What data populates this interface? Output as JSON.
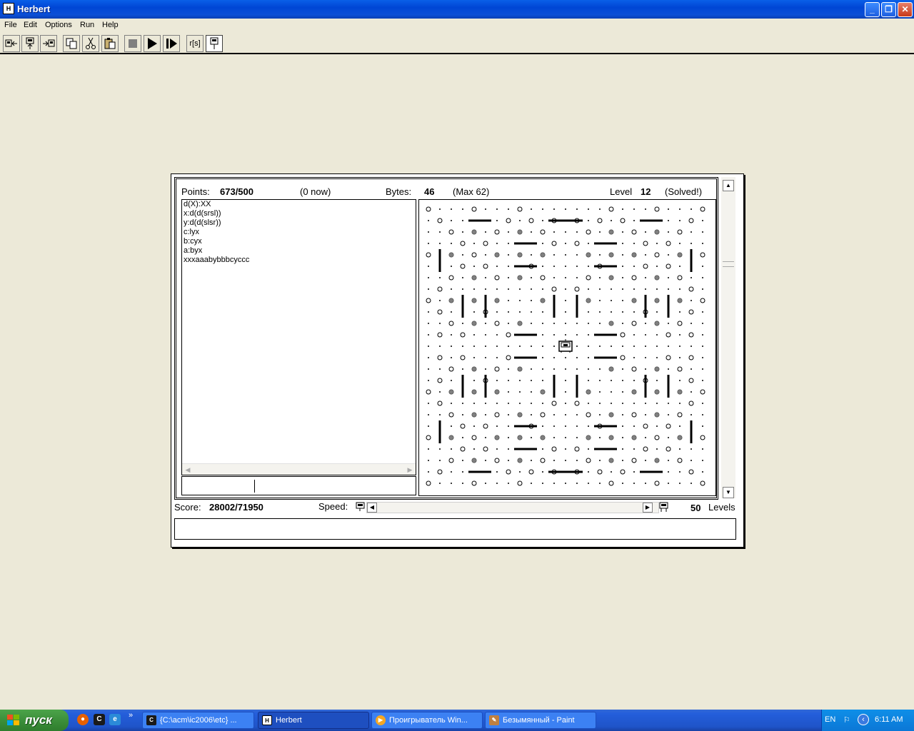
{
  "window": {
    "title": "Herbert",
    "icon_label": "H",
    "controls": [
      "minimize",
      "restore",
      "close"
    ]
  },
  "menu": [
    "File",
    "Edit",
    "Options",
    "Run",
    "Help"
  ],
  "toolbar": {
    "buttons": [
      {
        "name": "prev-level-button",
        "icon": "prev-level-icon"
      },
      {
        "name": "load-button",
        "icon": "load-icon"
      },
      {
        "name": "next-level-button",
        "icon": "next-level-icon"
      },
      {
        "name": "copy-button",
        "icon": "copy-icon"
      },
      {
        "name": "cut-button",
        "icon": "scissors-icon"
      },
      {
        "name": "paste-button",
        "icon": "paste-icon"
      },
      {
        "name": "stop-button",
        "icon": "stop-icon"
      },
      {
        "name": "run-button",
        "icon": "play-icon"
      },
      {
        "name": "step-button",
        "icon": "step-icon"
      },
      {
        "name": "syntax-button",
        "icon": "syntax-icon",
        "label": "r[s]"
      },
      {
        "name": "herbert-button",
        "icon": "robot-icon"
      }
    ]
  },
  "stats": {
    "points_label": "Points:",
    "points_value": "673/500",
    "points_now": "(0 now)",
    "bytes_label": "Bytes:",
    "bytes_value": "46",
    "bytes_max": "(Max 62)",
    "level_label": "Level",
    "level_value": "12",
    "level_status": "(Solved!)"
  },
  "code": {
    "lines": [
      "d(X):XX",
      "x:d(d(srsl))",
      "y:d(d(slsr))",
      "c:lyx",
      "b:cyx",
      "a:byx",
      "xxxaaabybbbcyccc"
    ],
    "input_value": ""
  },
  "bottom": {
    "score_label": "Score:",
    "score_value": "28002/71950",
    "speed_label": "Speed:",
    "speed_level": 0.98,
    "levels_value": "50",
    "levels_label": "Levels"
  },
  "status_message": "",
  "board": {
    "grid_size": 25,
    "robot_cell": [
      12,
      12
    ],
    "colors": {
      "dot": "#000000",
      "ring": "#000000",
      "filled": "#808080",
      "wall": "#000000"
    }
  },
  "taskbar": {
    "start_label": "пуск",
    "quick_launch": [
      "firefox-icon",
      "far-icon",
      "terminal-icon",
      "ie-icon"
    ],
    "tasks": [
      {
        "label": "{C:\\acm\\ic2006\\etc} ...",
        "icon": "far-icon",
        "active": false
      },
      {
        "label": "Herbert",
        "icon": "herbert-icon",
        "active": true
      },
      {
        "label": "Проигрыватель Win...",
        "icon": "media-player-icon",
        "active": false
      },
      {
        "label": "Безымянный - Paint",
        "icon": "paint-icon",
        "active": false
      }
    ],
    "tray": {
      "lang": "EN",
      "time": "6:11 AM"
    }
  }
}
